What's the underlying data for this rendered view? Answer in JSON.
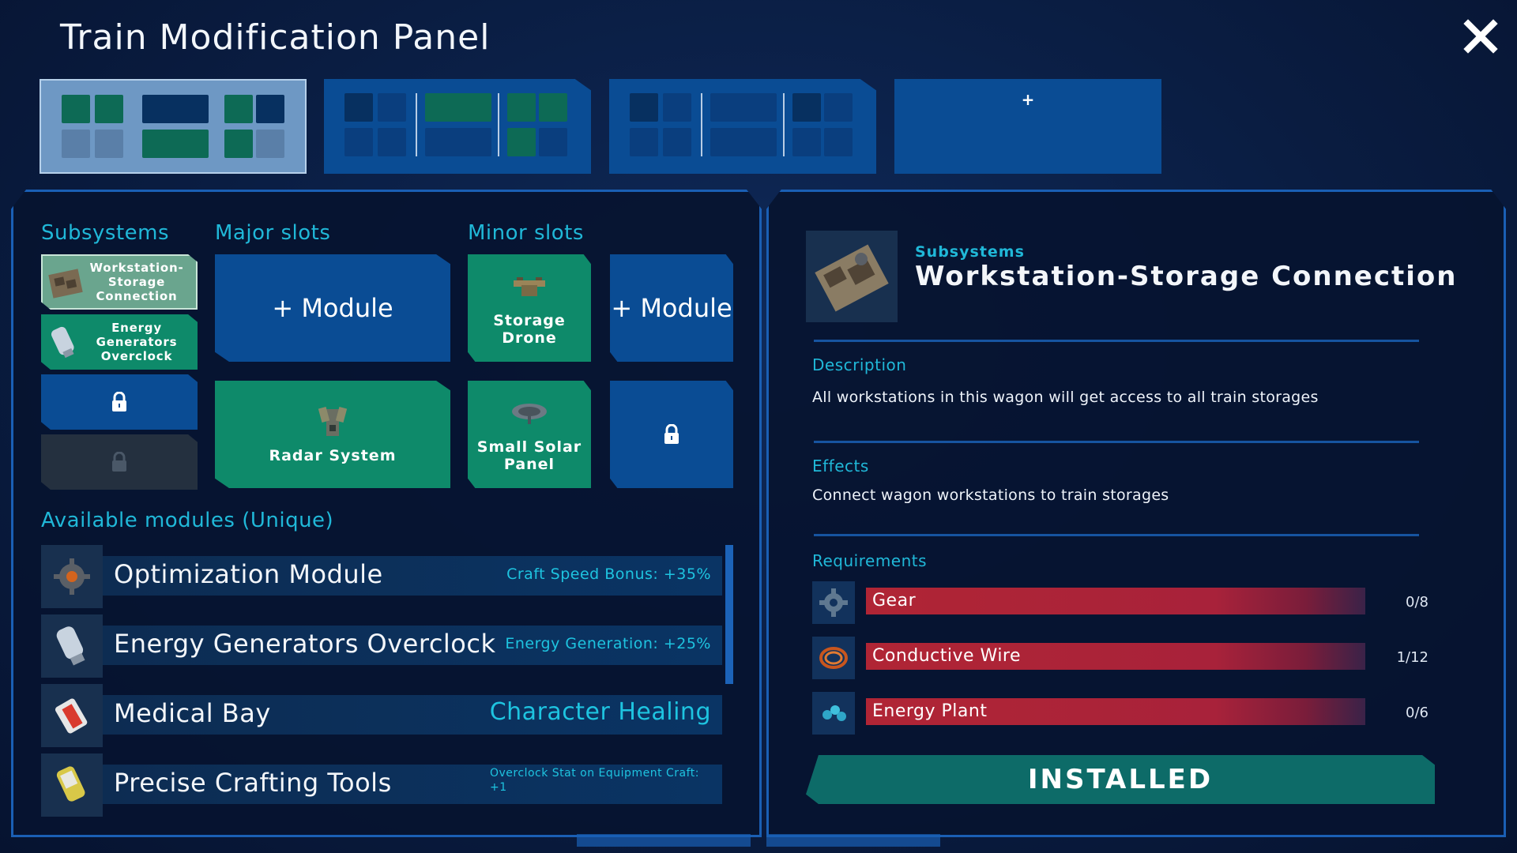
{
  "window": {
    "title": "Train Modification Panel"
  },
  "wagons": {
    "add_label": "+"
  },
  "sections": {
    "subsystems": "Subsystems",
    "major": "Major slots",
    "minor": "Minor slots",
    "available": "Available modules (Unique)"
  },
  "subsystems": [
    {
      "label": "Workstation-Storage Connection",
      "state": "selected"
    },
    {
      "label": "Energy Generators Overclock",
      "state": "installed"
    },
    {
      "label": "",
      "state": "locked"
    },
    {
      "label": "",
      "state": "locked-disabled"
    }
  ],
  "major_slots": [
    {
      "label": "+ Module"
    },
    {
      "label": "Radar System"
    }
  ],
  "minor_slots": [
    {
      "label": "Storage Drone"
    },
    {
      "label": "+ Module"
    },
    {
      "label": "Small Solar Panel"
    },
    {
      "label": ""
    }
  ],
  "modules": [
    {
      "name": "Optimization Module",
      "effect": "Craft Speed Bonus: +35%"
    },
    {
      "name": "Energy Generators Overclock",
      "effect": "Energy Generation: +25%"
    },
    {
      "name": "Medical Bay",
      "effect": "Character Healing"
    },
    {
      "name": "Precise Crafting Tools",
      "effect": "Overclock Stat on Equipment Craft: +1"
    }
  ],
  "detail": {
    "category": "Subsystems",
    "name": "Workstation-Storage Connection",
    "description_label": "Description",
    "description": "All workstations in this wagon will get access to all train storages",
    "effects_label": "Effects",
    "effects": "Connect wagon workstations to train storages",
    "requirements_label": "Requirements",
    "requirements": [
      {
        "name": "Gear",
        "count": "0/8",
        "have": 0,
        "need": 8
      },
      {
        "name": "Conductive Wire",
        "count": "1/12",
        "have": 1,
        "need": 12
      },
      {
        "name": "Energy Plant",
        "count": "0/6",
        "have": 0,
        "need": 6
      }
    ],
    "status": "INSTALLED"
  },
  "colors": {
    "accent": "#20b8d8",
    "slot_blue": "#0a4c94",
    "slot_green": "#0e8a6a",
    "requirement_red": "#b02535",
    "installed_teal": "#0d6b68"
  },
  "icons": {
    "close": "close-icon",
    "lock": "lock-icon",
    "workstation": "workstation-storage-icon",
    "canister": "energy-canister-icon",
    "radar": "radar-system-icon",
    "drone": "storage-drone-icon",
    "solar": "solar-panel-icon",
    "gear": "gear-icon",
    "wire": "wire-coil-icon",
    "plant": "energy-plant-icon",
    "medical": "medical-bay-icon",
    "tools": "crafting-tools-icon"
  }
}
